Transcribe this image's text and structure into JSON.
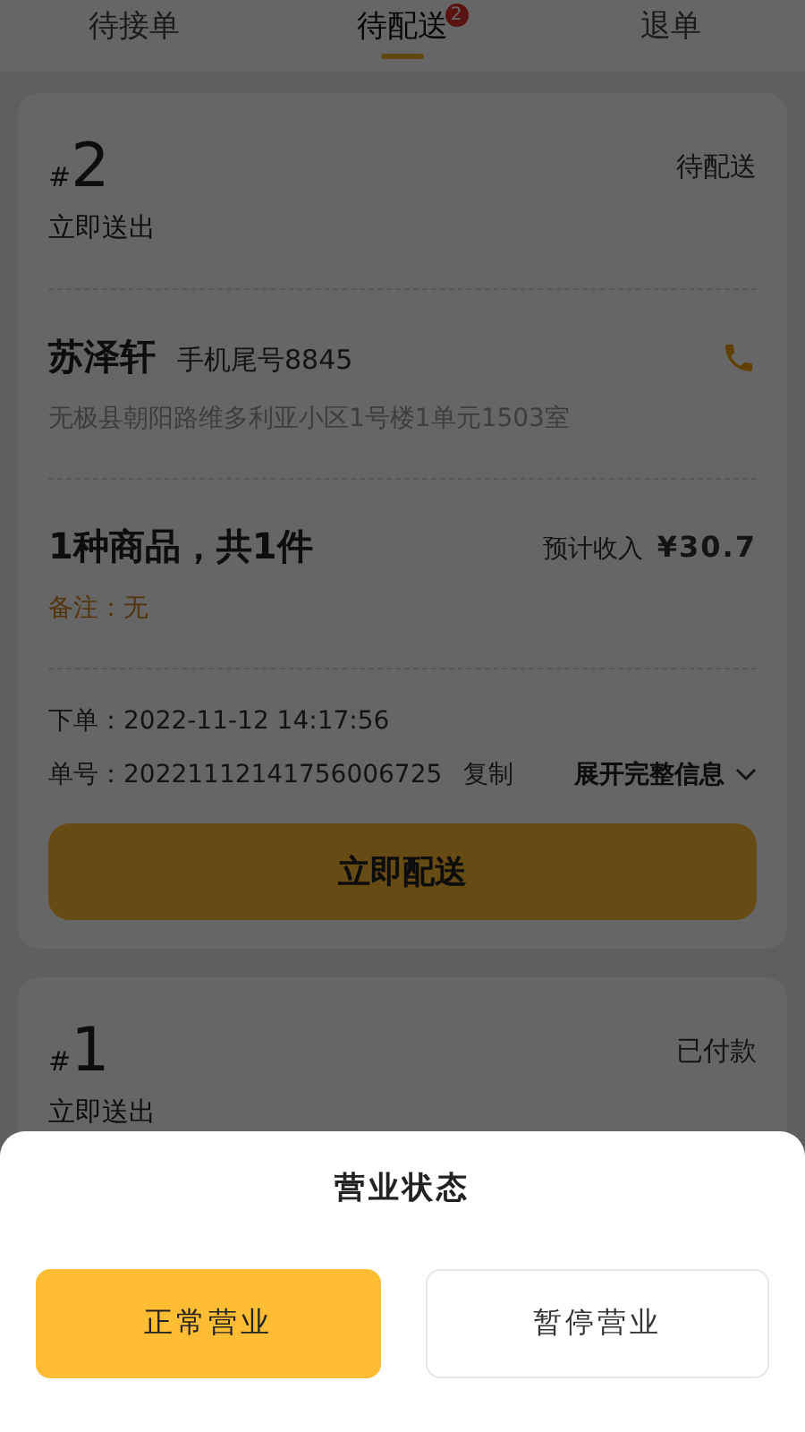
{
  "tabs": [
    {
      "label": "待接单",
      "selected": false
    },
    {
      "label": "待配送",
      "selected": true,
      "badge": "2"
    },
    {
      "label": "退单",
      "selected": false
    }
  ],
  "orders": [
    {
      "hash": "#",
      "number": "2",
      "status": "待配送",
      "delivery": "立即送出",
      "customer_name": "苏泽轩",
      "phone_hint": "手机尾号8845",
      "address": "无极县朝阳路维多利亚小区1号楼1单元1503室",
      "summary": "1种商品，共1件",
      "income_label": "预计收入",
      "income": "¥30.7",
      "note": "备注：无",
      "placed_label": "下单：",
      "placed_time": "2022-11-12 14:17:56",
      "order_no_label": "单号：",
      "order_no": "20221112141756006725",
      "copy_label": "复制",
      "expand_label": "展开完整信息",
      "action_label": "立即配送"
    },
    {
      "hash": "#",
      "number": "1",
      "status": "已付款",
      "delivery": "立即送出"
    }
  ],
  "sheet": {
    "title": "营业状态",
    "options": [
      {
        "label": "正常营业",
        "selected": true
      },
      {
        "label": "暂停营业",
        "selected": false
      }
    ]
  }
}
